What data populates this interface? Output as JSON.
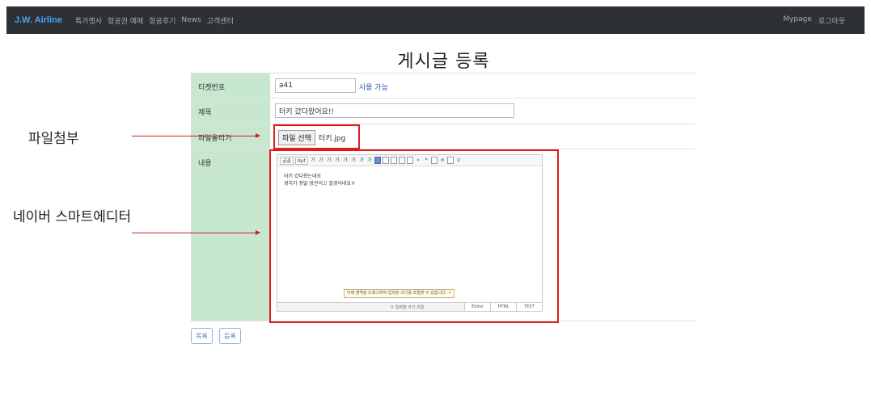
{
  "nav": {
    "brand": "J.W. Airline",
    "items": [
      "특가행사",
      "항공권 예매",
      "항공후기",
      "News",
      "고객센터"
    ],
    "right_items": [
      "Mypage",
      "로그아웃"
    ]
  },
  "page": {
    "title": "게시글 등록"
  },
  "form": {
    "ticket": {
      "label": "티켓번호",
      "value": "a41",
      "status": "사용 가능"
    },
    "subject": {
      "label": "제목",
      "value": "터키 갔다왔어요!!"
    },
    "file": {
      "label": "파일올리기",
      "button": "파일 선택",
      "filename": "터키.jpg"
    },
    "content": {
      "label": "내용"
    }
  },
  "editor": {
    "font_select": "글꼴",
    "size_select": "9pt",
    "lines": [
      "터키 갔다왔는데요",
      "경치가 정말 장관이고 절경이네요ㅎ"
    ],
    "tooltip": "아래 영역을 드래그하여 입력창 크기를 조절할 수 있습니다.",
    "resize_label": "⇕ 입력창 크기 조절",
    "modes": [
      "Editor",
      "HTML",
      "TEXT"
    ]
  },
  "buttons": {
    "list": "목록",
    "submit": "등록"
  },
  "annotations": {
    "file": "파일첨부",
    "editor": "네이버 스마트에디터"
  },
  "colors": {
    "navbar": "#2d3035",
    "brand": "#4aa3f0",
    "label_bg": "#c8e7cf",
    "highlight": "#e01b1b",
    "available": "#2d54b8"
  }
}
